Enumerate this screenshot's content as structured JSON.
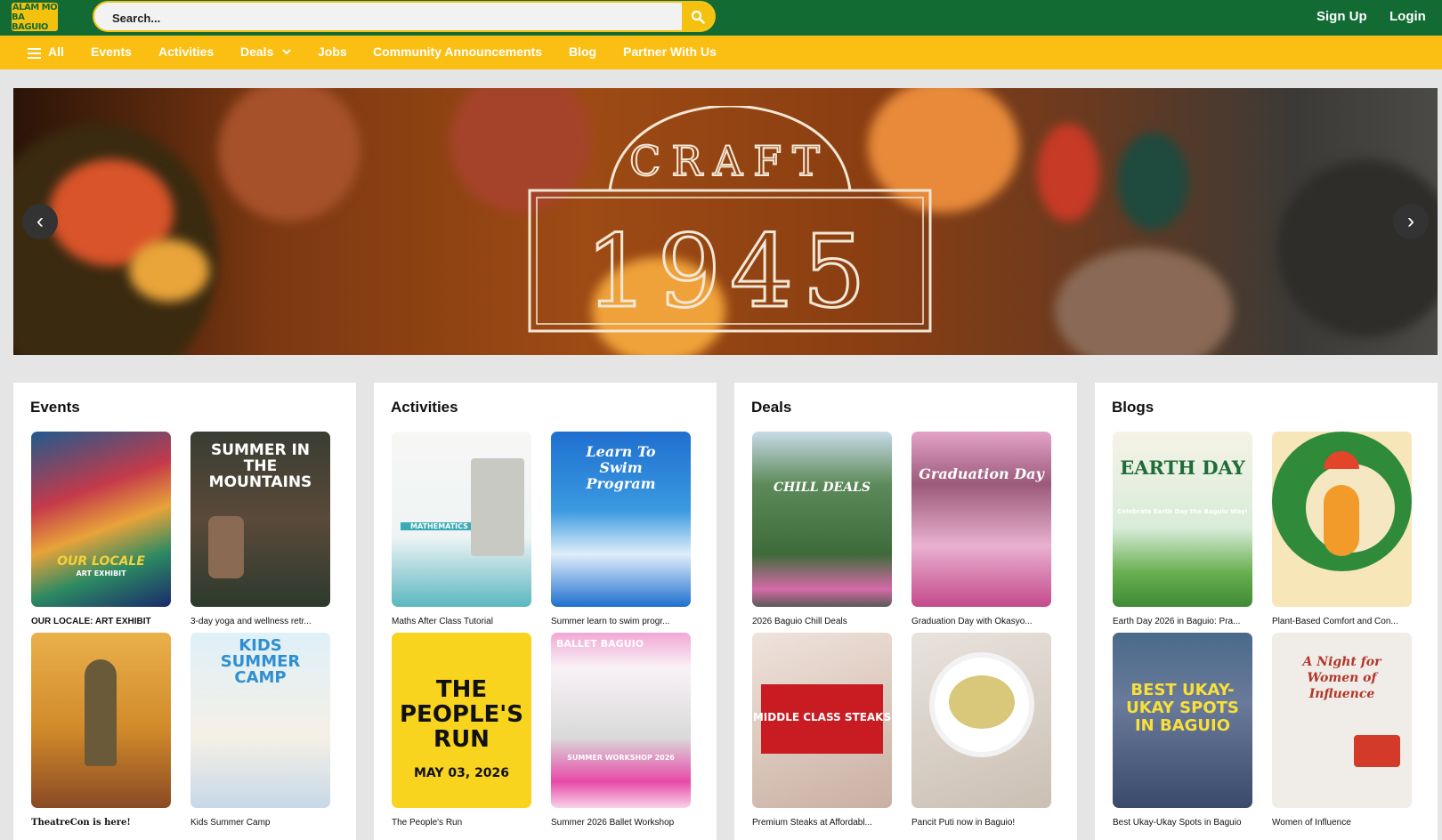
{
  "header": {
    "logo_line1": "ALAM MO",
    "logo_line2": "BA BAGUIO",
    "search_placeholder": "Search...",
    "signup_label": "Sign Up",
    "login_label": "Login",
    "colors": {
      "green": "#136b34",
      "yellow": "#fbbf14"
    }
  },
  "nav": {
    "all": "All",
    "items": [
      "Events",
      "Activities",
      "Deals",
      "Jobs",
      "Community Announcements",
      "Blog",
      "Partner With Us"
    ]
  },
  "hero": {
    "sign_top": "CRAFT",
    "sign_main": "1945",
    "prev_icon": "‹",
    "next_icon": "›"
  },
  "sections": [
    {
      "title": "Events",
      "items": [
        {
          "caption": "OUR LOCALE: ART EXHIBIT",
          "img_text": "OUR LOCALE",
          "img_sub": "ART EXHIBIT"
        },
        {
          "caption": "3-day yoga and wellness retr...",
          "img_text": "SUMMER IN THE MOUNTAINS"
        },
        {
          "caption": "TheatreCon is here!",
          "img_text": ""
        },
        {
          "caption": "Kids Summer Camp",
          "img_text": "KIDS SUMMER CAMP"
        }
      ]
    },
    {
      "title": "Activities",
      "items": [
        {
          "caption": "Maths After Class Tutorial",
          "img_text": "MATHEMATICS"
        },
        {
          "caption": "Summer learn to swim progr...",
          "img_text": "Learn To Swim Program"
        },
        {
          "caption": "The People's Run",
          "img_text": "THE PEOPLE'S RUN",
          "img_sub": "MAY 03, 2026"
        },
        {
          "caption": "Summer 2026 Ballet Workshop",
          "img_text": "BALLET BAGUIO",
          "img_sub": "SUMMER WORKSHOP 2026"
        }
      ]
    },
    {
      "title": "Deals",
      "items": [
        {
          "caption": "2026 Baguio Chill Deals",
          "img_text": "CHILL DEALS"
        },
        {
          "caption": "Graduation Day with Okasyo...",
          "img_text": "Graduation Day"
        },
        {
          "caption": "Premium Steaks at Affordabl...",
          "img_text": "MIDDLE CLASS STEAKS"
        },
        {
          "caption": "Pancit Puti now in Baguio!",
          "img_text": ""
        }
      ]
    },
    {
      "title": "Blogs",
      "items": [
        {
          "caption": "Earth Day 2026 in Baguio: Pra...",
          "img_text": "EARTH DAY",
          "img_sub": "Celebrate Earth Day the Baguio Way!"
        },
        {
          "caption": "Plant-Based Comfort and Con...",
          "img_text": ""
        },
        {
          "caption": "Best Ukay-Ukay Spots in Baguio",
          "img_text": "BEST UKAY-UKAY SPOTS IN BAGUIO"
        },
        {
          "caption": "Women of Influence",
          "img_text": "A Night for Women of Influence"
        }
      ]
    }
  ]
}
